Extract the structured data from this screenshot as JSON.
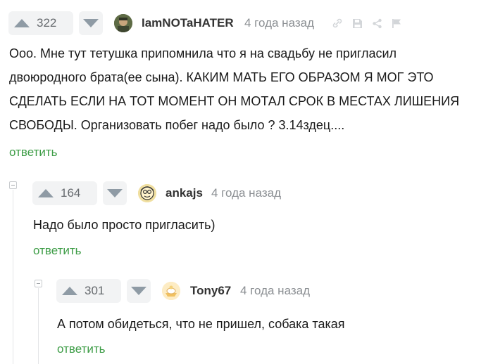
{
  "comments": [
    {
      "score": "322",
      "author": "IamNOTaHATER",
      "time": "4 года назад",
      "text": [
        "Ооо. Мне тут тетушка припомнила что я на свадьбу не пригласил",
        "двоюродного брата(ее сына). КАКИМ МАТЬ ЕГО ОБРАЗОМ Я МОГ ЭТО",
        "СДЕЛАТЬ ЕСЛИ НА ТОТ МОМЕНТ ОН МОТАЛ СРОК В МЕСТАХ ЛИШЕНИЯ",
        "СВОБОДЫ. Организовать побег надо было ? 3.14здец...."
      ],
      "reply": "ответить"
    },
    {
      "score": "164",
      "author": "ankajs",
      "time": "4 года назад",
      "text": [
        "Надо было просто пригласить)"
      ],
      "reply": "ответить"
    },
    {
      "score": "301",
      "author": "Tony67",
      "time": "4 года назад",
      "text": [
        "А потом обидеться, что не пришел, собака такая"
      ],
      "reply": "ответить"
    }
  ],
  "icons": {
    "upvote": "upvote-arrow-icon",
    "downvote": "downvote-arrow-icon",
    "link": "link-icon",
    "save": "save-icon",
    "share": "share-icon",
    "report": "flag-icon",
    "collapse": "collapse-icon"
  },
  "colors": {
    "reply": "#3e9d47",
    "vote_bg": "#f2f3f4",
    "arrow": "#8f9ba5",
    "muted": "#8b8f93"
  }
}
